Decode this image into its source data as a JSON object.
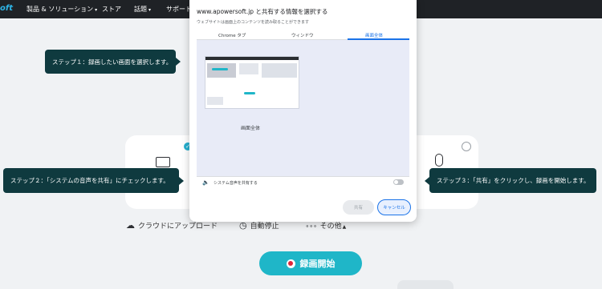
{
  "nav": {
    "logo": "oft",
    "items": [
      {
        "label": "製品 & ソリューション",
        "chevron": true
      },
      {
        "label": "ストア",
        "chevron": false
      },
      {
        "label": "話題",
        "chevron": true
      },
      {
        "label": "サポート",
        "chevron": false
      }
    ]
  },
  "dialog": {
    "title": "www.apowersoft.jp と共有する情報を選択する",
    "subtitle": "ウェブサイトは画面上のコンテンツを読み取ることができます",
    "tabs": [
      {
        "label": "Chrome タブ",
        "active": false
      },
      {
        "label": "ウィンドウ",
        "active": false
      },
      {
        "label": "画面全体",
        "active": true
      }
    ],
    "thumbnail_label": "画面全体",
    "audio_label": "システム音声を共有する",
    "share_button": "共有",
    "cancel_button": "キャンセル"
  },
  "callouts": {
    "step1": "ステップ１：録画したい画面を選択します。",
    "step2": "ステップ２：「システムの音声を共有」にチェックします。",
    "step3": "ステップ３：「共有」をクリックし、録画を開始します。"
  },
  "options": {
    "cloud": "クラウドにアップロード",
    "auto_stop": "自動停止",
    "more": "その他"
  },
  "record_button": "録画開始",
  "colors": {
    "accent": "#1fb6c8",
    "callout_bg": "#0f3a3f",
    "link_blue": "#1a73e8"
  }
}
